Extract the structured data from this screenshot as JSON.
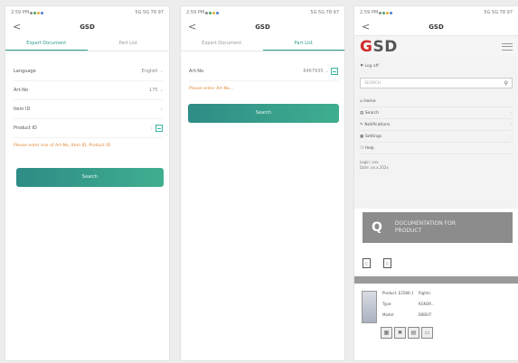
{
  "status_bar": {
    "left": "2:59 PM",
    "right": "5G 5G 78 97"
  },
  "app": {
    "title": "GSD",
    "back_glyph": "<"
  },
  "phone1": {
    "tabs": [
      "Expert Document",
      "Part List"
    ],
    "fields": [
      {
        "label": "Language",
        "value": "English"
      },
      {
        "label": "Art-No",
        "value": "175"
      },
      {
        "label": "Item ID",
        "value": ""
      },
      {
        "label": "Product ID",
        "value": ""
      }
    ],
    "warning": "Please enter one of Art-No, Item ID, Product ID",
    "search_label": "Search"
  },
  "phone2": {
    "tabs": [
      "Expert Document",
      "Part List"
    ],
    "fields": [
      {
        "label": "Art-No",
        "value": "6467935"
      }
    ],
    "warning": "Please enter Art-No...",
    "search_label": "Search"
  },
  "phone3": {
    "logo_g": "G",
    "logo_rest": "SD",
    "login": "Log off",
    "search_placeholder": "SEARCH",
    "menu_items": [
      "Home",
      "Search",
      "Notifications",
      "Settings",
      "Help"
    ],
    "login_info": [
      "Login: xxx",
      "Date: xx.x.202x"
    ],
    "doc_banner_line1": "DOCUMENTATION FOR",
    "doc_banner_line2": "PRODUCT",
    "product_info": [
      [
        "Product: E2586-1",
        "Rights:"
      ],
      [
        "Type:",
        "KGN39..."
      ],
      [
        "Model:",
        "B0B0I7"
      ]
    ]
  },
  "colors": {
    "accent": "#2b9c8c",
    "warning": "#e08a3a",
    "logo_red": "#d12b2b"
  },
  "icons": [
    "back-icon",
    "scan-icon",
    "chevron-right-icon",
    "search-icon",
    "menu-icon",
    "file-pdf-icon"
  ]
}
